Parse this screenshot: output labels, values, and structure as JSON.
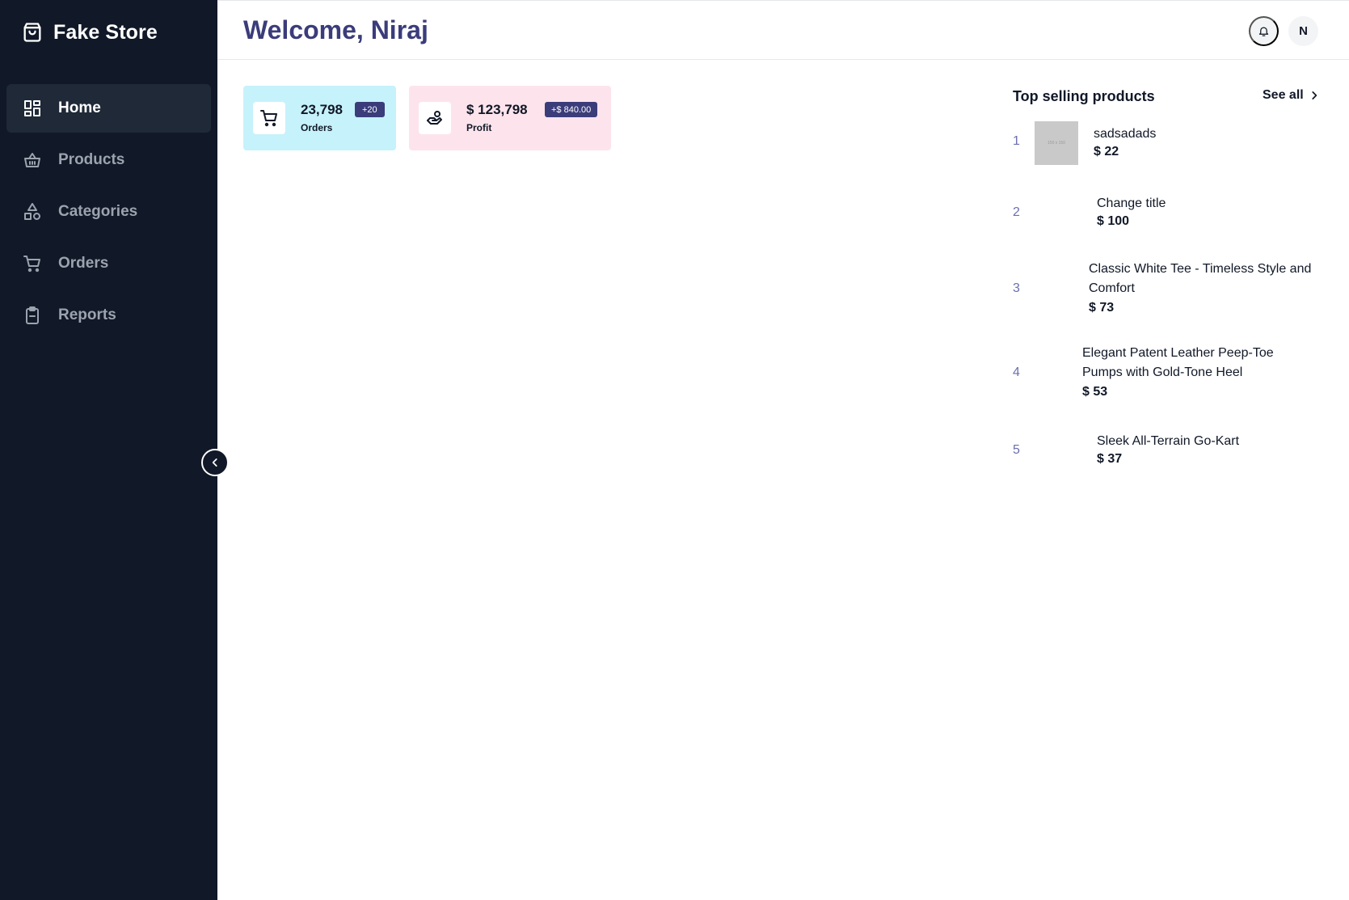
{
  "brand": {
    "name": "Fake Store",
    "icon": "shopping-bag-icon"
  },
  "sidebar": {
    "items": [
      {
        "label": "Home",
        "icon": "grid-icon",
        "active": true
      },
      {
        "label": "Products",
        "icon": "basket-icon",
        "active": false
      },
      {
        "label": "Categories",
        "icon": "shapes-icon",
        "active": false
      },
      {
        "label": "Orders",
        "icon": "cart-icon",
        "active": false
      },
      {
        "label": "Reports",
        "icon": "clipboard-icon",
        "active": false
      }
    ],
    "collapse_icon": "chevron-left-icon"
  },
  "header": {
    "welcome": "Welcome,",
    "user_name": "Niraj",
    "avatar_initial": "N",
    "bell_icon": "bell-icon"
  },
  "stats": {
    "orders": {
      "value": "23,798",
      "label": "Orders",
      "badge": "+20",
      "icon": "cart-icon"
    },
    "profit": {
      "value": "$ 123,798",
      "label": "Profit",
      "badge": "+$ 840.00",
      "icon": "hand-coin-icon"
    }
  },
  "top_selling": {
    "title": "Top selling products",
    "see_all": "See all",
    "products": [
      {
        "rank": "1",
        "name": "sadsadads",
        "price": "$ 22",
        "thumb_text": "150 x 150"
      },
      {
        "rank": "2",
        "name": "Change title",
        "price": "$ 100"
      },
      {
        "rank": "3",
        "name": "Classic White Tee - Timeless Style and Comfort",
        "price": "$ 73"
      },
      {
        "rank": "4",
        "name": "Elegant Patent Leather Peep-Toe Pumps with Gold-Tone Heel",
        "price": "$ 53"
      },
      {
        "rank": "5",
        "name": "Sleek All-Terrain Go-Kart",
        "price": "$ 37"
      }
    ]
  },
  "colors": {
    "sidebar_bg": "#111827",
    "accent": "#3b3c7a",
    "orders_card": "#c6f2fb",
    "profit_card": "#fde4ec"
  }
}
